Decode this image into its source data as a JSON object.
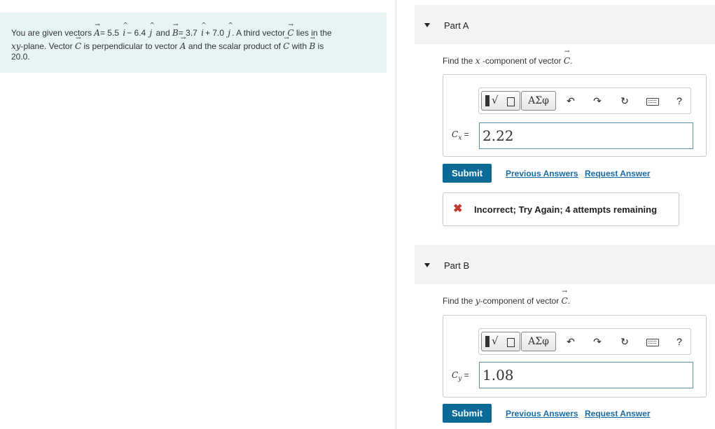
{
  "problem": {
    "t1": "You are given vectors ",
    "vecA": "A",
    "t2": "= 5.5 ",
    "i": "i",
    "t3": "− 6.4 ",
    "j": "j",
    "t4": " and ",
    "vecB": "B",
    "t5": "= 3.7 ",
    "t6": "+ 7.0 ",
    "t7": ". A third vector ",
    "vecC": "C",
    "t8": " lies in the",
    "xy": "xy",
    "t9": "-plane. Vector ",
    "t10": " is perpendicular to vector ",
    "t11": " and the scalar product of ",
    "t12": " with ",
    "t13": " is",
    "t14": "20.0."
  },
  "partA": {
    "title": "Part A",
    "prompt_pre": "Find the ",
    "prompt_var": "x",
    "prompt_post": " -component of vector ",
    "prompt_vec": "C",
    "prompt_end": ".",
    "toolbar": {
      "greek": "ΑΣφ",
      "help": "?"
    },
    "label_var": "C",
    "label_sub": "x",
    "label_eq": " =",
    "value": "2.22",
    "submit": "Submit",
    "prev": "Previous Answers",
    "request": "Request Answer",
    "feedback": "Incorrect; Try Again; 4 attempts remaining",
    "feedback_icon": "✖"
  },
  "partB": {
    "title": "Part B",
    "prompt_pre": "Find the ",
    "prompt_var": "y",
    "prompt_post": "-component of vector ",
    "prompt_vec": "C",
    "prompt_end": ".",
    "toolbar": {
      "greek": "ΑΣφ",
      "help": "?"
    },
    "label_var": "C",
    "label_sub": "y",
    "label_eq": " =",
    "value": "1.08",
    "submit": "Submit",
    "prev": "Previous Answers",
    "request": "Request Answer"
  },
  "icons": {
    "undo": "↶",
    "redo": "↷",
    "reset": "↻",
    "keyboard": "keyboard-icon",
    "arrow_left": "⬑",
    "arrow_right": "⬏"
  }
}
